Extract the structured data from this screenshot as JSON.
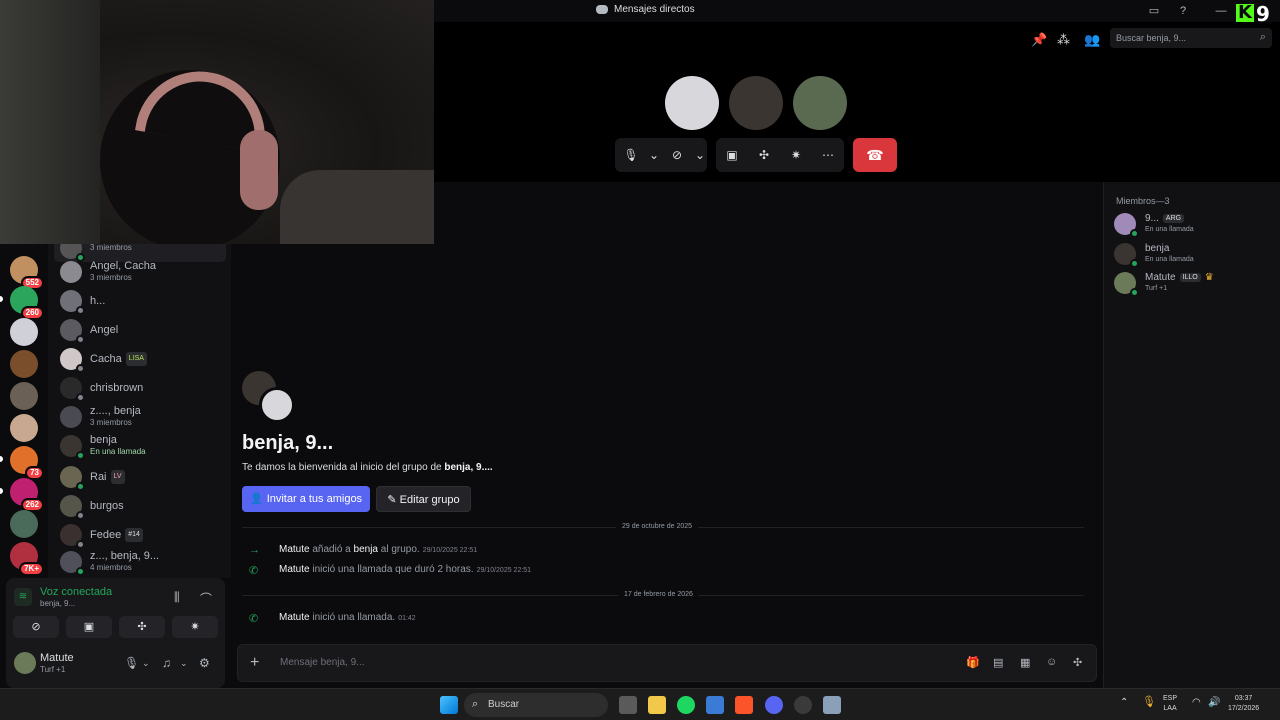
{
  "window": {
    "title": "Mensajes directos",
    "logo_k": "K",
    "logo_n": "9"
  },
  "colors": {
    "accent": "#5865f2",
    "online": "#23a55a",
    "danger": "#da373c",
    "badge": "#f23f43"
  },
  "rail": {
    "badges": [
      "552",
      "260",
      "73",
      "262",
      "7K+"
    ]
  },
  "dmlist": {
    "items": [
      {
        "name": "",
        "sub": "3 miembros"
      },
      {
        "name": "Angel, Cacha",
        "sub": "3 miembros"
      },
      {
        "name": "h...",
        "sub": ""
      },
      {
        "name": "Angel",
        "sub": ""
      },
      {
        "name": "Cacha",
        "tag": "LISA",
        "sub": ""
      },
      {
        "name": "chrisbrown",
        "sub": ""
      },
      {
        "name": "z...., benja",
        "sub": "3 miembros"
      },
      {
        "name": "benja",
        "sub": "En una llamada"
      },
      {
        "name": "Rai",
        "tag": "LV",
        "sub": ""
      },
      {
        "name": "burgos",
        "sub": ""
      },
      {
        "name": "Fedee",
        "tag": "#14",
        "sub": ""
      },
      {
        "name": "z..., benja, 9...",
        "sub": "4 miembros"
      }
    ]
  },
  "voice": {
    "title": "Voz conectada",
    "sub": "benja, 9..."
  },
  "user": {
    "name": "Matute",
    "status": "Turf +1"
  },
  "search": {
    "placeholder": "Buscar benja, 9..."
  },
  "group": {
    "title": "benja, 9...",
    "welcome_prefix": "Te damos la bienvenida al inicio del grupo de",
    "welcome_name": "benja, 9....",
    "invite": "Invitar a tus amigos",
    "edit": "Editar grupo"
  },
  "messages": {
    "date1": "29 de octubre de 2025",
    "date2": "17 de febrero de 2026",
    "m1": {
      "actor": "Matute",
      "verb": "añadió a",
      "target": "benja",
      "rest": "al grupo.",
      "ts": "29/10/2025 22:51"
    },
    "m2": {
      "actor": "Matute",
      "text": "inició una llamada que duró 2 horas.",
      "ts": "29/10/2025 22:51"
    },
    "m3": {
      "actor": "Matute",
      "text": "inició una llamada.",
      "ts": "01:42"
    }
  },
  "composer": {
    "placeholder": "Mensaje benja, 9..."
  },
  "members": {
    "header": "Miembros—3",
    "list": [
      {
        "name": "9...",
        "tag": "ARG",
        "sub": "En una llamada"
      },
      {
        "name": "benja",
        "tag": "",
        "sub": "En una llamada"
      },
      {
        "name": "Matute",
        "tag": "ILLO",
        "sub": "Turf +1"
      }
    ]
  },
  "taskbar": {
    "search": "Buscar",
    "lang1": "ESP",
    "lang2": "LAA",
    "time": "03:37",
    "date": "17/2/2026"
  }
}
